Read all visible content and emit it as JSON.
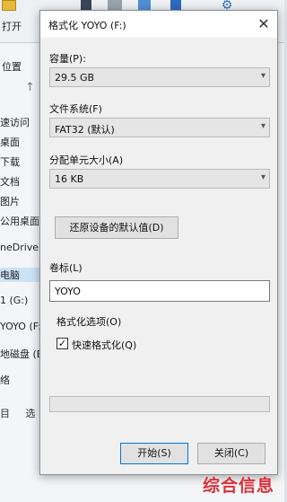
{
  "explorer": {
    "open_label": "打开",
    "location_label": "位置",
    "up_arrow_icon": "up-arrow-icon",
    "nav_items": [
      {
        "label": "速访问",
        "selected": false
      },
      {
        "label": "桌面",
        "selected": false
      },
      {
        "label": "下载",
        "selected": false
      },
      {
        "label": "文档",
        "selected": false
      },
      {
        "label": "图片",
        "selected": false
      },
      {
        "label": "公用桌面",
        "selected": false
      },
      {
        "label": "neDrive",
        "selected": false
      },
      {
        "label": "电脑",
        "selected": true
      },
      {
        "label": "1 (G:)",
        "selected": false
      },
      {
        "label": "YOYO (F:)",
        "selected": false
      },
      {
        "label": "地磁盘 (E:",
        "selected": false
      },
      {
        "label": "络",
        "selected": false
      }
    ],
    "status": [
      "目",
      "选"
    ]
  },
  "dialog": {
    "title": "格式化 YOYO (F:)",
    "close_icon": "close-icon",
    "capacity": {
      "label": "容量(P):",
      "value": "29.5 GB"
    },
    "filesystem": {
      "label": "文件系统(F)",
      "value": "FAT32 (默认)"
    },
    "allocation": {
      "label": "分配单元大小(A)",
      "value": "16 KB"
    },
    "restore_defaults_label": "还原设备的默认值(D)",
    "volume_label": {
      "label": "卷标(L)",
      "value": "YOYO"
    },
    "format_options_label": "格式化选项(O)",
    "quick_format": {
      "label": "快速格式化(Q)",
      "checked": true
    },
    "progress": 0,
    "start_label": "开始(S)",
    "close_label": "关闭(C)"
  },
  "watermark": "综合信息",
  "colors": {
    "accent": "#0078d7",
    "watermark": "#d8303a",
    "progress": "#06b025"
  }
}
